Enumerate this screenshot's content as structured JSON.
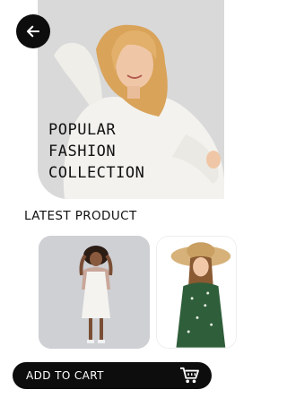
{
  "hero": {
    "title_lines": [
      "POPULAR",
      "FASHION",
      "COLLECTION"
    ]
  },
  "back_icon": "arrow-left-icon",
  "latest": {
    "title": "LATEST PRODUCT"
  },
  "cart": {
    "label": "ADD TO CART",
    "icon": "cart-icon"
  },
  "colors": {
    "hero_bg": "#d9d9d9",
    "button_bg": "#0d0d0d",
    "text": "#111111"
  }
}
